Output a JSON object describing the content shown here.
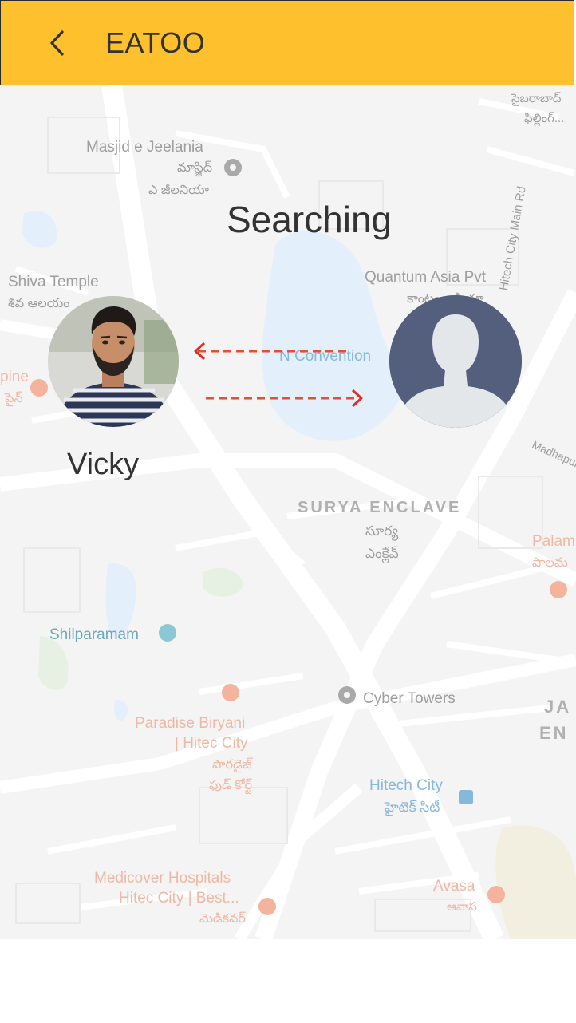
{
  "appbar": {
    "title": "EATOO",
    "back_icon": "chevron-left-icon",
    "background": "#fec02d"
  },
  "status": {
    "text": "Searching"
  },
  "user": {
    "name": "Vicky"
  },
  "connection": {
    "arrow_color": "#f04b2d"
  },
  "map": {
    "labels": {
      "masjid": "Masjid e Jeelania",
      "masjid_te1": "మాస్జిద్",
      "masjid_te2": "ఎ జీలనియా",
      "shiva": "Shiva Temple",
      "shiva_te": "శివ ఆలయం",
      "quantum": "Quantum Asia Pvt",
      "quantum_te": "కాంటం ఆసియా",
      "convention": "N Convention",
      "surya": "SURYA ENCLAVE",
      "surya_te1": "సూర్య",
      "surya_te2": "ఎంక్లేవ్",
      "palam": "Palam",
      "palam_te": "పాలమ",
      "shilparamam": "Shilparamam",
      "cyber": "Cyber Towers",
      "paradise1": "Paradise Biryani",
      "paradise2": "| Hitec City",
      "paradise_te1": "పారడైజ్",
      "paradise_te2": "ఫుడ్ కోర్ట్",
      "hitech": "Hitech City",
      "hitech_te": "హైటెక్ సిటీ",
      "medicover1": "Medicover Hospitals",
      "medicover2": "Hitec City | Best...",
      "medicover_te": "మెడికవర్",
      "avasa": "Avasa",
      "avasa_te": "ఆవాస",
      "road": "Hitech City Main Rd",
      "madhapur": "Madhapur",
      "ja": "JA",
      "en": "EN",
      "pine": "pine",
      "pine_te": "పైన్",
      "top_te1": "సైబరాబాద్",
      "top_te2": "ఫిల్లింగ్..."
    }
  }
}
